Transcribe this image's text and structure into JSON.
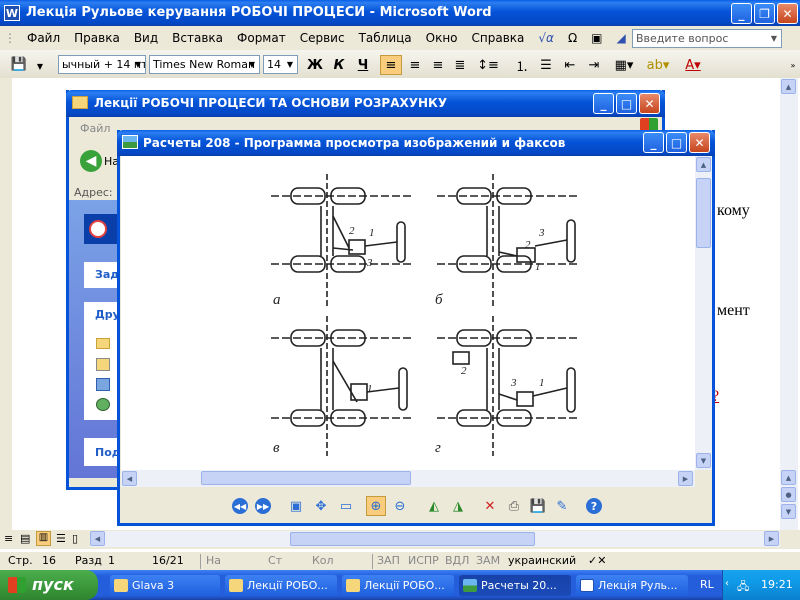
{
  "word": {
    "title": "Лекція Рульове керування РОБОЧІ ПРОЦЕСИ - Microsoft Word",
    "menu": [
      "Файл",
      "Правка",
      "Вид",
      "Вставка",
      "Формат",
      "Сервис",
      "Таблица",
      "Окно",
      "Справка"
    ],
    "help_placeholder": "Введите вопрос",
    "style_value": "ычный + 14 пт",
    "font_value": "Times New Roman",
    "size_value": "14",
    "fmt_bold": "Ж",
    "fmt_italic": "К",
    "fmt_underline": "Ч",
    "doc_fragments": [
      "кому",
      "мент",
      "?"
    ],
    "status": {
      "page": "Стр.",
      "page_num": "16",
      "section": "Разд",
      "section_num": "1",
      "pages": "16/21",
      "at": "На",
      "line": "Ст",
      "col": "Кол",
      "rec": "ЗАП",
      "trk": "ИСПР",
      "ext": "ВДЛ",
      "ovr": "ЗАМ",
      "lang": "украинский"
    }
  },
  "explorer": {
    "title": "Лекції РОБОЧІ ПРОЦЕСИ ТА ОСНОВИ РОЗРАХУНКУ",
    "menu_file": "Файл",
    "back_label": "На",
    "address_label": "Адрес:",
    "panel_tasks": "Зад",
    "panel_other": "Дру",
    "panel_details": "Под"
  },
  "viewer": {
    "title": "Расчеты 208 - Программа просмотра изображений и факсов",
    "diagram_labels": {
      "a": "а",
      "b": "б",
      "v": "в",
      "g": "г",
      "n1": "1",
      "n2": "2",
      "n3": "3"
    }
  },
  "taskbar": {
    "start": "пуск",
    "items": [
      {
        "label": "Glava 3",
        "active": false
      },
      {
        "label": "Лекції РОБО...",
        "active": false
      },
      {
        "label": "Лекції РОБО...",
        "active": false
      },
      {
        "label": "Расчеты 20...",
        "active": true
      },
      {
        "label": "Лекція Руль...",
        "active": false
      }
    ],
    "lang": "RL",
    "clock": "19:21"
  },
  "colors": {
    "xp_blue": "#0553d8",
    "taskbar": "#245edb",
    "start_green": "#3c9a3c",
    "tray": "#0f9ae8",
    "word_bg": "#ece9d8"
  }
}
